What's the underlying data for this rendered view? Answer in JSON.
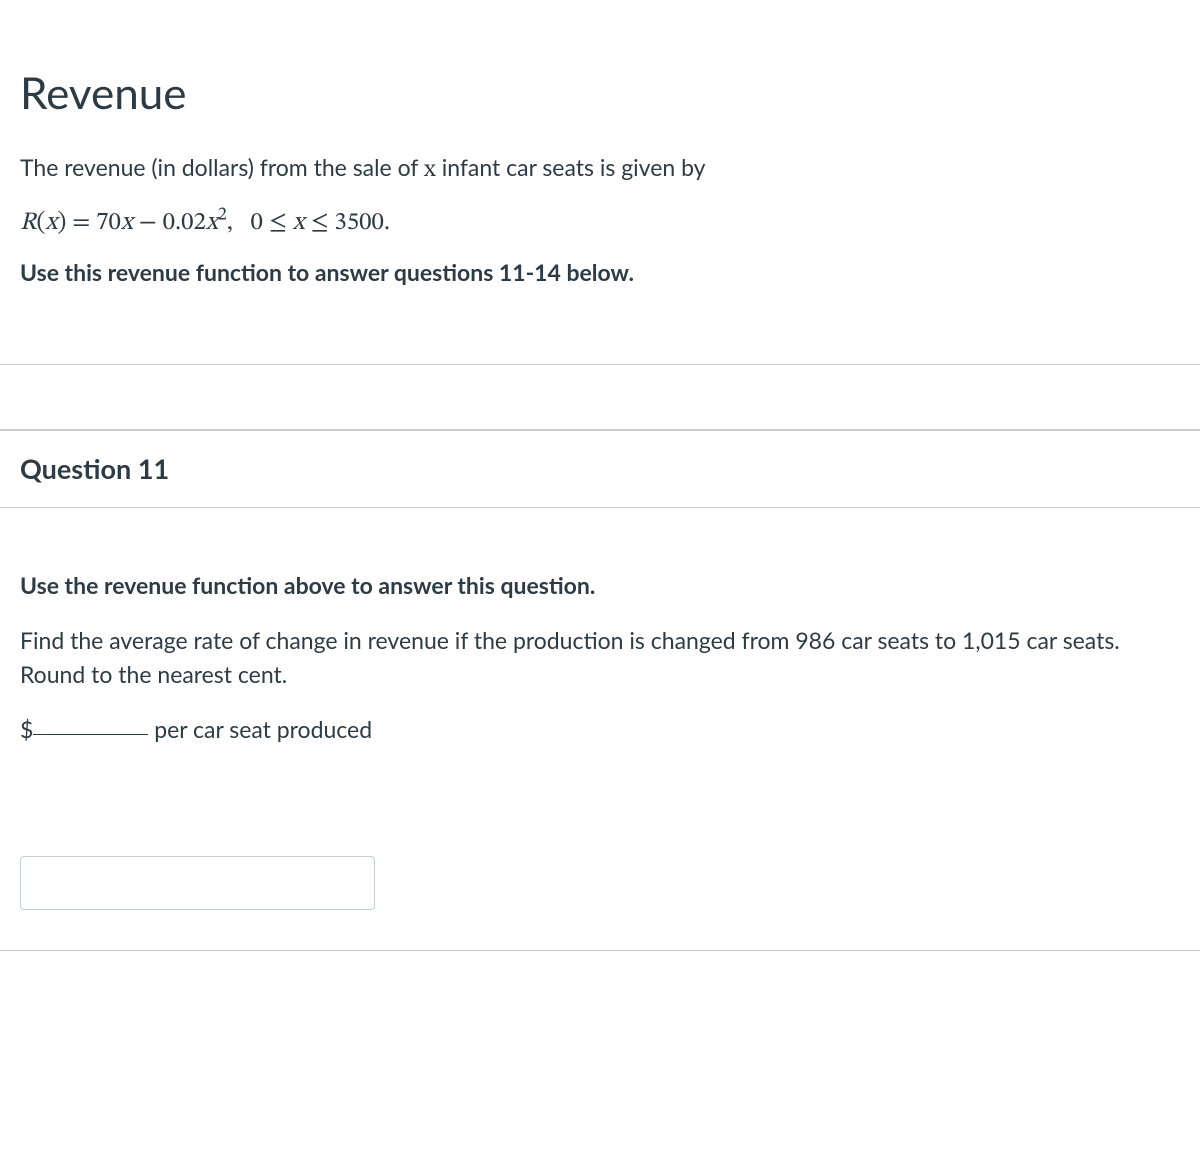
{
  "title": "Revenue",
  "intro": {
    "line1_pre": "The revenue (in dollars) from the sale of ",
    "line1_var": "x",
    "line1_post": " infant car seats is given by",
    "formula_text": "R(x) = 70x − 0.02x²,   0 ≤ x ≤ 3500.",
    "instructions": "Use this revenue function to answer questions 11-14 below."
  },
  "question": {
    "header": "Question 11",
    "instruction": "Use the revenue function above to answer this question.",
    "prompt": "Find the average rate of change in revenue if the production is changed from 986 car seats to 1,015 car seats.  Round to the nearest cent.",
    "answer_prefix": "$",
    "answer_suffix": " per car seat produced",
    "input_value": ""
  }
}
